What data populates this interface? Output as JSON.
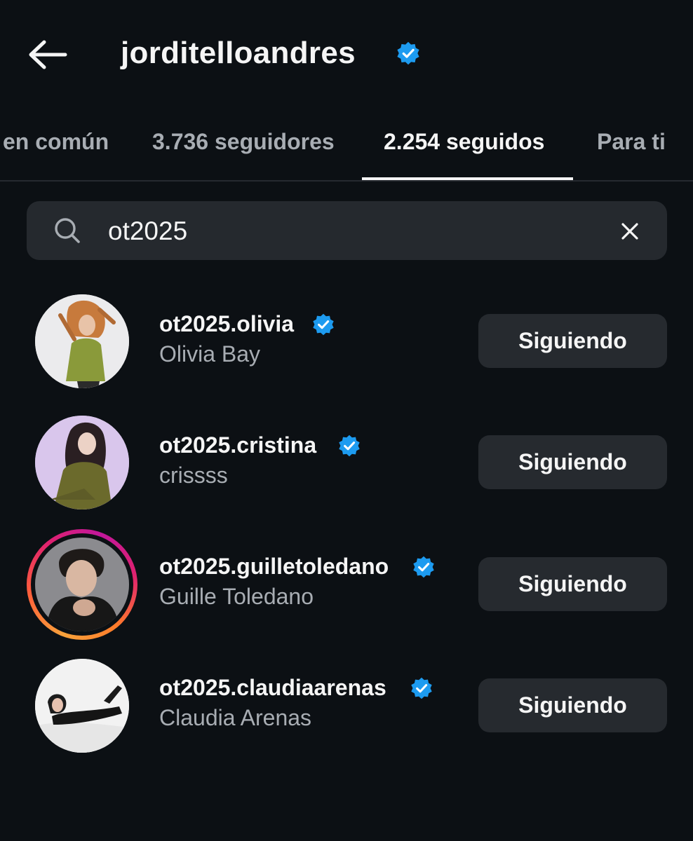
{
  "header": {
    "title": "jorditelloandres",
    "verified": true
  },
  "tabs": [
    {
      "label": "en común",
      "active": false
    },
    {
      "label": "3.736 seguidores",
      "active": false
    },
    {
      "label": "2.254 seguidos",
      "active": true
    },
    {
      "label": "Para ti",
      "active": false
    }
  ],
  "search": {
    "value": "ot2025",
    "icon": "search-icon",
    "clear_icon": "close-icon"
  },
  "users": [
    {
      "username": "ot2025.olivia",
      "full_name": "Olivia Bay",
      "verified": true,
      "has_story": false,
      "button_label": "Siguiendo"
    },
    {
      "username": "ot2025.cristina",
      "full_name": "crissss",
      "verified": true,
      "has_story": false,
      "button_label": "Siguiendo"
    },
    {
      "username": "ot2025.guilletoledano",
      "full_name": "Guille Toledano",
      "verified": true,
      "has_story": true,
      "button_label": "Siguiendo"
    },
    {
      "username": "ot2025.claudiaarenas",
      "full_name": "Claudia Arenas",
      "verified": true,
      "has_story": false,
      "button_label": "Siguiendo"
    }
  ],
  "colors": {
    "background": "#0c1014",
    "verified_badge": "#1d9bf0",
    "button_bg": "#262a2f",
    "secondary_text": "#a8adb3"
  }
}
